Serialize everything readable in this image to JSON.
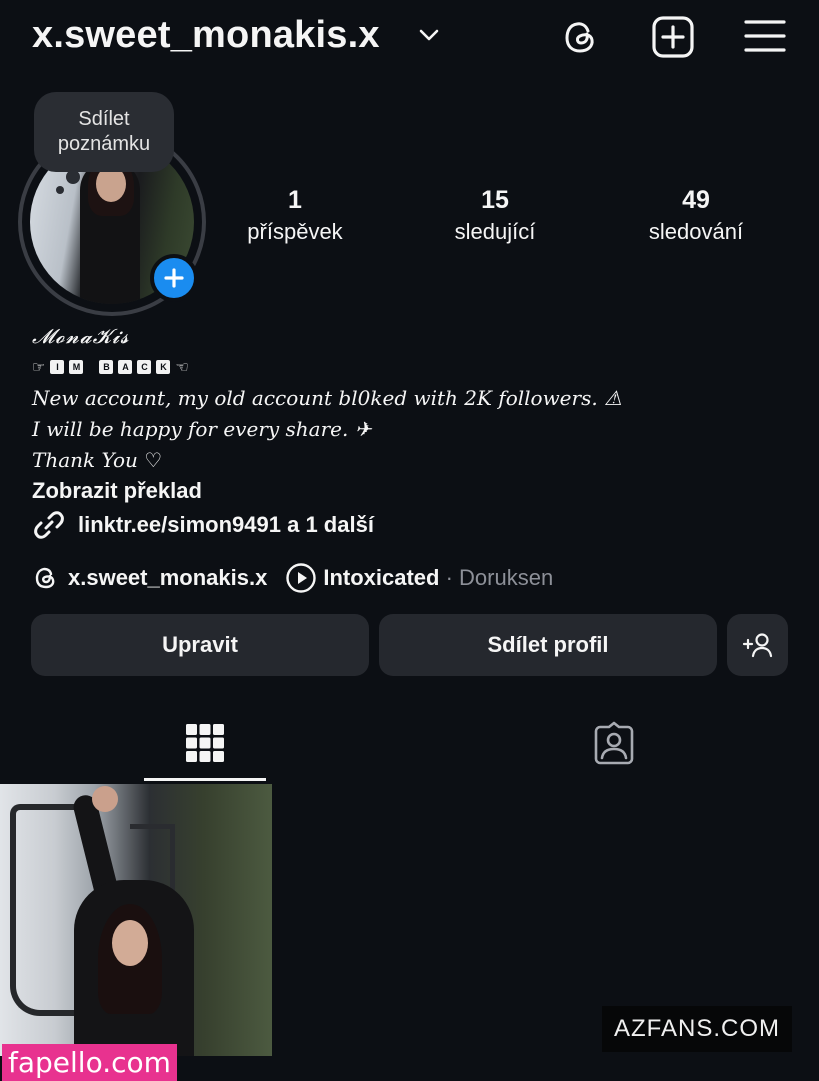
{
  "header": {
    "username": "x.sweet_monakis.x",
    "icons": [
      "chevron-down-icon",
      "threads-icon",
      "add-post-icon",
      "menu-icon"
    ]
  },
  "profile": {
    "note_line1": "Sdílet",
    "note_line2": "poznámku",
    "stats": [
      {
        "value": "1",
        "label": "příspěvek"
      },
      {
        "value": "15",
        "label": "sledující"
      },
      {
        "value": "49",
        "label": "sledování"
      }
    ]
  },
  "bio": {
    "display_name": "𝓜𝓸𝓷𝓪𝓚𝓲𝓼",
    "im_back_left": "☞",
    "im_back_letters_1": [
      "I",
      "M"
    ],
    "im_back_letters_2": [
      "B",
      "A",
      "C",
      "K"
    ],
    "im_back_right": "☜",
    "line1": "New account, my old account bl0ked with 2K followers. ⚠",
    "line2": "I will be happy for every share. ✈",
    "line3": "Thank You ♡",
    "translate": "Zobrazit překlad",
    "link": "linktr.ee/simon9491 a 1 další",
    "threads_handle": "x.sweet_monakis.x",
    "music_title": "Intoxicated",
    "music_separator": " · ",
    "music_artist": "Doruksen"
  },
  "buttons": {
    "edit": "Upravit",
    "share": "Sdílet profil"
  },
  "tabs": [
    {
      "name": "grid",
      "active": true
    },
    {
      "name": "tagged",
      "active": false
    }
  ],
  "watermarks": {
    "fapello": "fapello.com",
    "azfans": "AZFANS.COM"
  },
  "colors": {
    "background": "#0c0f14",
    "button": "#25282e",
    "accent_blue": "#1a8cf0",
    "muted_text": "#8d9098"
  }
}
